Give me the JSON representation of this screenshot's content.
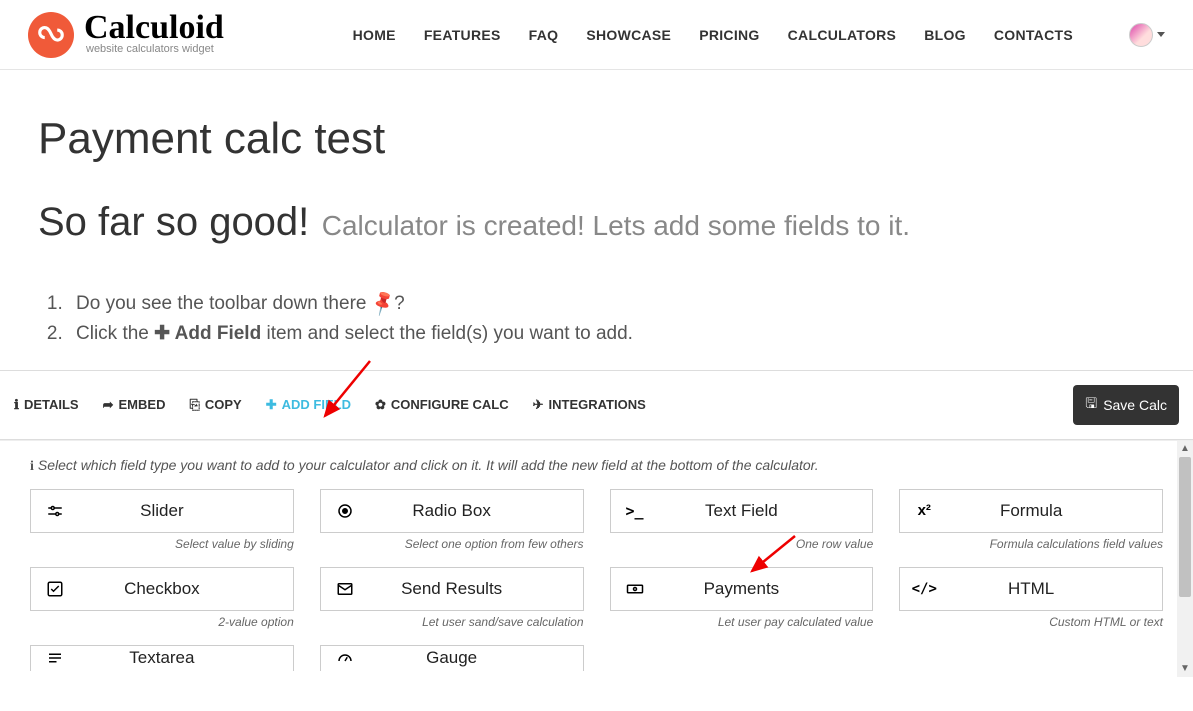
{
  "brand": {
    "name": "Calculoid",
    "tagline": "website calculators widget"
  },
  "nav": {
    "home": "HOME",
    "features": "FEATURES",
    "faq": "FAQ",
    "showcase": "SHOWCASE",
    "pricing": "PRICING",
    "calculators": "CALCULATORS",
    "blog": "BLOG",
    "contacts": "CONTACTS"
  },
  "page": {
    "title": "Payment calc test",
    "subhead": "So far so good!",
    "subnote": "Calculator is created! Lets add some fields to it."
  },
  "steps": {
    "s1_a": "Do you see the toolbar down there ",
    "s1_b": "?",
    "s2_a": "Click the ",
    "s2_b": "Add Field",
    "s2_c": " item and select the field(s) you want to add."
  },
  "toolbar": {
    "details": "DETAILS",
    "embed": "EMBED",
    "copy": "COPY",
    "addfield": "ADD FIELD",
    "configure": "CONFIGURE CALC",
    "integrations": "INTEGRATIONS",
    "save": "Save Calc"
  },
  "panel": {
    "hint": "Select which field type you want to add to your calculator and click on it. It will add the new field at the bottom of the calculator."
  },
  "fields": {
    "slider": {
      "label": "Slider",
      "desc": "Select value by sliding"
    },
    "radio": {
      "label": "Radio Box",
      "desc": "Select one option from few others"
    },
    "text": {
      "label": "Text Field",
      "desc": "One row value"
    },
    "formula": {
      "label": "Formula",
      "desc": "Formula calculations field values"
    },
    "checkbox": {
      "label": "Checkbox",
      "desc": "2-value option"
    },
    "send": {
      "label": "Send Results",
      "desc": "Let user sand/save calculation"
    },
    "payments": {
      "label": "Payments",
      "desc": "Let user pay calculated value"
    },
    "html": {
      "label": "HTML",
      "desc": "Custom HTML or text"
    },
    "textarea": {
      "label": "Textarea"
    },
    "gauge": {
      "label": "Gauge"
    }
  }
}
